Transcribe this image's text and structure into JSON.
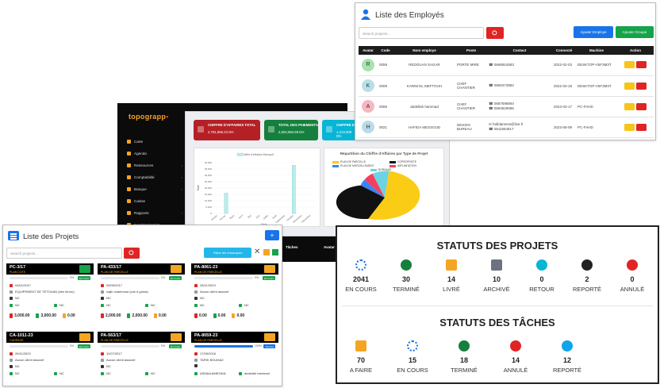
{
  "sidebar": {
    "logo": "topograpp",
    "items": [
      {
        "label": "Carte"
      },
      {
        "label": "Agenda"
      },
      {
        "label": "Ressources"
      },
      {
        "label": "Comptabilité"
      },
      {
        "label": "Banque"
      },
      {
        "label": "Caisse"
      },
      {
        "label": "Rapports"
      },
      {
        "label": "Synchronisation"
      }
    ]
  },
  "dashboard": {
    "kpis": [
      {
        "title": "CHIFFRE D'AFFAIRES TOTAL",
        "value": "2,791,955.22 DH",
        "color": "#b52025"
      },
      {
        "title": "TOTAL DES PAIEMENTS",
        "value": "2,504,994.58 DH",
        "color": "#15803d"
      },
      {
        "title": "CHIFFRE D'AFFAIRES",
        "value": "1,213,009 DH",
        "color": "#06b6d4"
      }
    ],
    "bar_chart": {
      "type": "bar",
      "legend": "Chiffre d'Affaires Mensuel",
      "ylabel": "Total",
      "xlabel": "Mois",
      "categories": [
        "Janvier",
        "Février",
        "Mars",
        "Avril",
        "Mai",
        "Juin",
        "Juillet",
        "Août",
        "Septembre",
        "Octobre",
        "Novembre",
        "Décembre"
      ],
      "values": [
        0,
        16000,
        0,
        0,
        0,
        0,
        0,
        0,
        0,
        38000,
        0,
        0,
        0
      ],
      "ylim": [
        0,
        40000
      ],
      "yticks": [
        "40,000",
        "35,000",
        "30,000",
        "25,000",
        "20,000",
        "15,000",
        "10,000",
        "5,000",
        "0"
      ]
    },
    "pie_chart": {
      "type": "pie",
      "title": "Répartition du Chiffre d'Affaires par Type de Projet",
      "legend": [
        "PLAN DE PARCELLE",
        "COPROPRIETE",
        "PLAN DE MORCELLEMENT",
        "IMPLANTATION",
        "BORNAGE"
      ],
      "colors": [
        "#facc15",
        "#111111",
        "#3b82f6",
        "#f43f5e",
        "#6dd3e0"
      ],
      "values": [
        58,
        22,
        4,
        6,
        10
      ]
    }
  },
  "employees": {
    "title": "Liste des Employés",
    "search_placeholder": "Search projects...",
    "add_employee": "Ajouter Employe",
    "add_group": "Ajouter Groupe",
    "columns": [
      "Avatar",
      "Code",
      "Nom employe",
      "Poste",
      "Contact",
      "Connecté",
      "Machine",
      "Action"
    ],
    "rows": [
      {
        "avatar": "R",
        "avatar_color": "#a7e3b0",
        "code": "0059",
        "name": "REDOUAN SAGAR",
        "poste": "PORTE MIRE",
        "contact": [
          "0668924583"
        ],
        "connected": "2022-02-03",
        "machine": "DESKTOP-V5F3M3T"
      },
      {
        "avatar": "K",
        "avatar_color": "#b8e0e6",
        "code": "0009",
        "name": "KARIM EL MEFTOUH",
        "poste": "CHEF CHANTIER",
        "contact": [
          "0666373882"
        ],
        "connected": "2022-03-18",
        "machine": "DESKTOP-V5F3M3T"
      },
      {
        "avatar": "A",
        "avatar_color": "#f6b7c1",
        "code": "0069",
        "name": "abdellah hammad",
        "poste": "CHEF CHANTIER",
        "contact": [
          "0687598894",
          "0594629086"
        ],
        "connected": "2023-03-17",
        "machine": "PC-FAHD"
      },
      {
        "avatar": "H",
        "avatar_color": "#b8dbe8",
        "code": "0021",
        "name": "HAFIDA MESSOUD",
        "poste": "DESSIN BUREAU",
        "contact": [
          "hafidamess@live.fr",
          "0611664817"
        ],
        "connected": "2023-08-09",
        "machine": "PC-FAHD"
      }
    ]
  },
  "projects": {
    "title": "Liste des Projets",
    "search_placeholder": "Search projects...",
    "filter_label": "Filtrer les remarques",
    "cards": [
      {
        "code": "PC-3/17",
        "type": "PLAN COTE",
        "folder": "#16a34a",
        "pct": "0%",
        "progress": 0,
        "status": "En cours",
        "date": "04/01/2017",
        "client": "EQUIPEMENT DE TETOUAN (ben kirrou)",
        "loc": "NC",
        "a": "NC",
        "b": "NC",
        "m1": "3,000.00",
        "m2": "3,000.00",
        "m3": "0.00"
      },
      {
        "code": "PA-433/17",
        "type": "PLAN DE PARCELLE",
        "folder": "#f5a524",
        "pct": "0%",
        "progress": 0,
        "status": "En cours",
        "date": "05/05/2017",
        "client": "najib chammout (cok d goma)",
        "loc": "NC",
        "a": "NC",
        "b": "NC",
        "m1": "2,000.00",
        "m2": "2,000.00",
        "m3": "0.00"
      },
      {
        "code": "PA-8061-23",
        "type": "PLAN DE PARCELLE",
        "folder": "#f5a524",
        "pct": "0%",
        "progress": 0,
        "status": "En cours",
        "date": "25/11/2023",
        "client": "Aucun client associé",
        "loc": "NC",
        "a": "NC",
        "b": "NC",
        "m1": "0.00",
        "m2": "0.00",
        "m3": "0.00"
      },
      {
        "code": "CA-1011-23",
        "type": "CADRAGE",
        "folder": "#f5a524",
        "pct": "0%",
        "progress": 0,
        "status": "En cours",
        "date": "26/11/2023",
        "client": "Aucun client associé",
        "loc": "NC",
        "a": "NC",
        "b": "NC"
      },
      {
        "code": "PA-563/17",
        "type": "PLAN DE PARCELLE",
        "folder": "#f5a524",
        "pct": "0%",
        "progress": 0,
        "status": "En cours",
        "date": "11/07/2017",
        "client": "Aucun client associé",
        "loc": "NC",
        "a": "NC",
        "b": "NC"
      },
      {
        "code": "PA-8059-23",
        "type": "PLAN DE PARCELLE",
        "folder": "#f5a524",
        "pct": "100%",
        "progress": 100,
        "status": "Terminé",
        "date": "17/05/2016",
        "client": "TARIK BOUMAZ",
        "loc": "",
        "a": "ASMAA AMEZIAN",
        "b": "abdellah hammad"
      }
    ]
  },
  "stats": {
    "projects_title": "STATUTS DES PROJETS",
    "tasks_title": "STATUTS DES TÂCHES",
    "projects": [
      {
        "num": "2041",
        "label": "EN COURS",
        "icon": "spinner-icon",
        "color": "#1a73e8"
      },
      {
        "num": "30",
        "label": "TERMINÉ",
        "icon": "check-circle-icon",
        "color": "#15803d"
      },
      {
        "num": "14",
        "label": "LIVRÉ",
        "icon": "clipboard-icon",
        "color": "#f5a524"
      },
      {
        "num": "10",
        "label": "ARCHIVÉ",
        "icon": "archive-icon",
        "color": "#6b7280"
      },
      {
        "num": "0",
        "label": "RETOUR",
        "icon": "undo-icon",
        "color": "#06b6d4"
      },
      {
        "num": "2",
        "label": "REPORTÉ",
        "icon": "clock-icon",
        "color": "#222222"
      },
      {
        "num": "0",
        "label": "ANNULÉ",
        "icon": "x-circle-icon",
        "color": "#e02424"
      }
    ],
    "tasks": [
      {
        "num": "70",
        "label": "A FAIRE",
        "icon": "list-icon",
        "color": "#f5a524"
      },
      {
        "num": "15",
        "label": "EN COURS",
        "icon": "spinner-icon",
        "color": "#1a73e8"
      },
      {
        "num": "18",
        "label": "TERMINÉ",
        "icon": "check-circle-icon",
        "color": "#15803d"
      },
      {
        "num": "14",
        "label": "ANNULÉ",
        "icon": "x-circle-icon",
        "color": "#e02424"
      },
      {
        "num": "12",
        "label": "REPORTÉ",
        "icon": "clock-icon",
        "color": "#0ea5e9"
      }
    ]
  },
  "strip": {
    "a": "Tâches",
    "b": "Avatar"
  }
}
